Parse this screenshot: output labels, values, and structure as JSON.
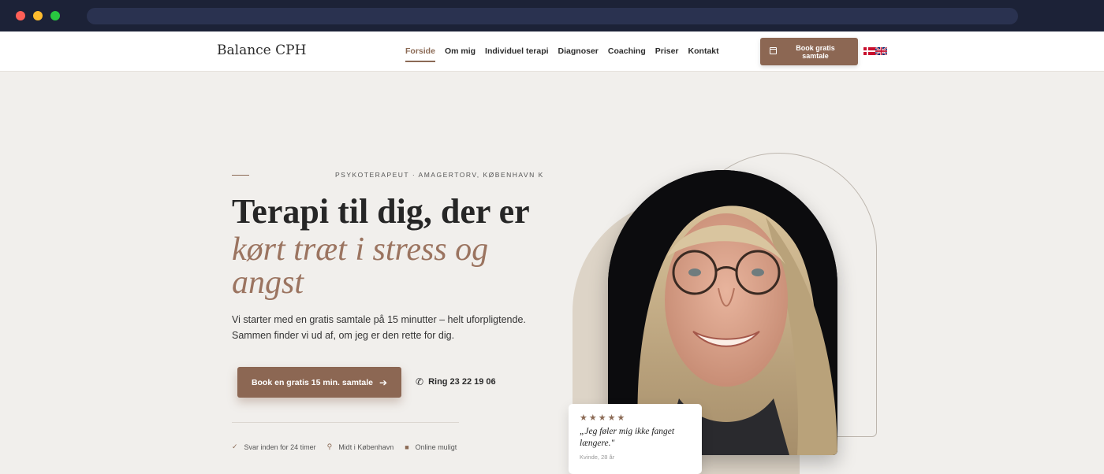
{
  "header": {
    "logo": "Balance CPH",
    "nav": [
      {
        "label": "Forside",
        "active": true
      },
      {
        "label": "Om mig"
      },
      {
        "label": "Individuel terapi"
      },
      {
        "label": "Diagnoser"
      },
      {
        "label": "Coaching"
      },
      {
        "label": "Priser"
      },
      {
        "label": "Kontakt"
      }
    ],
    "book_button": "Book gratis samtale",
    "languages": [
      "flag-dk-icon",
      "flag-uk-icon"
    ]
  },
  "hero": {
    "eyebrow": "PSYKOTERAPEUT · AMAGERTORV, KØBENHAVN K",
    "heading_line1": "Terapi til dig, der er",
    "heading_line2": "kørt træt i stress og angst",
    "lead": "Vi starter med en gratis samtale på 15 minutter – helt uforpligtende. Sammen finder vi ud af, om jeg er den rette for dig.",
    "cta_label": "Book en gratis 15 min. samtale",
    "phone_label": "Ring 23 22 19 06",
    "features": [
      {
        "icon": "check-icon",
        "label": "Svar inden for 24 timer"
      },
      {
        "icon": "pin-icon",
        "label": "Midt i København"
      },
      {
        "icon": "video-icon",
        "label": "Online muligt"
      }
    ]
  },
  "review": {
    "stars": "★★★★★",
    "quote": "„Jeg føler mig ikke fanget længere.\"",
    "author": "Kvinde, 28 år"
  },
  "colors": {
    "accent": "#8c6753",
    "accent_text": "#9b7460",
    "background": "#f1efec",
    "chrome": "#1c2237"
  }
}
